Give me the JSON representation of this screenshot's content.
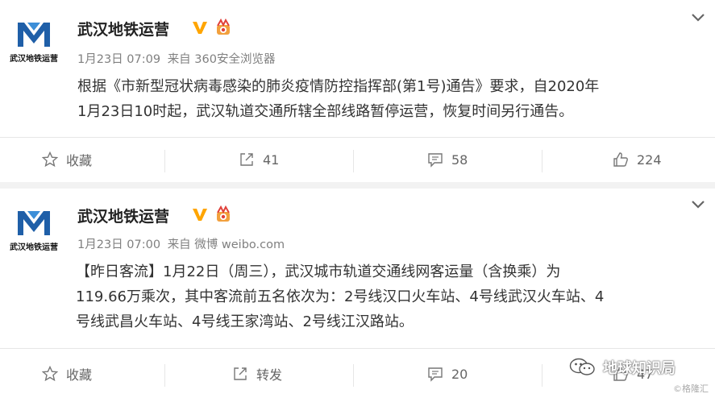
{
  "posts": [
    {
      "account_name": "武汉地铁运营",
      "logo_text": "武汉地铁运营",
      "time": "1月23日 07:09",
      "source": "来自 360安全浏览器",
      "body_line1": "根据《市新型冠状病毒感染的肺炎疫情防控指挥部(第1号)通告》要求，自2020年",
      "body_line2": "1月23日10时起，武汉轨道交通所辖全部线路暂停运营，恢复时间另行通告。",
      "actions": {
        "favorite": "收藏",
        "repost": "41",
        "comment": "58",
        "like": "224"
      }
    },
    {
      "account_name": "武汉地铁运营",
      "logo_text": "武汉地铁运营",
      "time": "1月23日 07:00",
      "source": "来自 微博 weibo.com",
      "body_line1": "【昨日客流】1月22日（周三），武汉城市轨道交通线网客运量（含换乘）为",
      "body_line2": "119.66万乘次，其中客流前五名依次为：2号线汉口火车站、4号线武汉火车站、4",
      "body_line3": "号线武昌火车站、4号线王家湾站、2号线江汉路站。",
      "actions": {
        "favorite": "收藏",
        "repost": "转发",
        "comment": "20",
        "like": "47"
      }
    }
  ],
  "watermark": {
    "text": "地球知识局",
    "sub": "©格隆汇"
  },
  "colors": {
    "verified": "#ffa500",
    "logo_blue": "#1f5fa8",
    "text_gray": "#808080"
  }
}
